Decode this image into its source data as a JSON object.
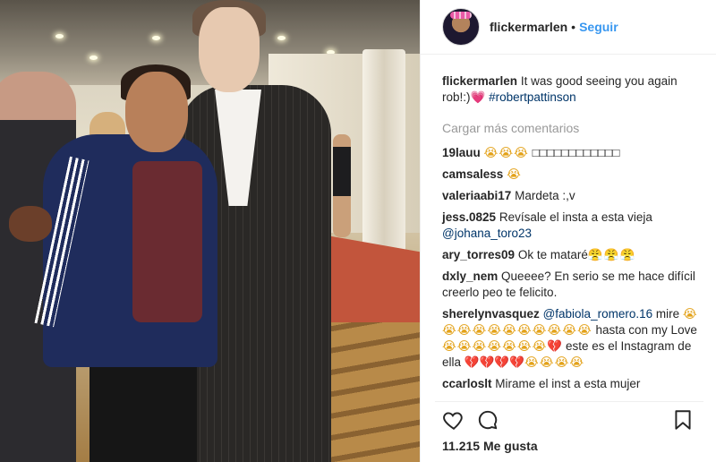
{
  "header": {
    "username": "flickermarlen",
    "separator": "•",
    "follow_label": "Seguir"
  },
  "caption": {
    "username": "flickermarlen",
    "text": "It was good seeing you again rob!:)",
    "emoji": "💗",
    "hashtag": "#robertpattinson"
  },
  "load_more_label": "Cargar más comentarios",
  "comments": [
    {
      "user": "19lauu",
      "text": "😭😭😭",
      "extra": "□□□□□□□□□□□□"
    },
    {
      "user": "camsaless",
      "text": "😭"
    },
    {
      "user": "valeriaabi17",
      "text": "Mardeta :,v"
    },
    {
      "user": "jess.0825",
      "text": "Revísale el insta a esta vieja",
      "mention": "@johana_toro23"
    },
    {
      "user": "ary_torres09",
      "text": "Ok te mataré",
      "emoji": "😤😤😤"
    },
    {
      "user": "dxly_nem",
      "text": "Queeee? En serio se me hace difícil creerlo peo te felicito."
    },
    {
      "user": "sherelynvasquez",
      "mention": "@fabiola_romero.16",
      "text_a": "mire",
      "emoji_a": "😭😭😭😭😭😭😭😭😭😭😭",
      "text_b": "hasta con my Love",
      "emoji_b": "😭😭😭😭😭😭😭",
      "heart_b": "💔",
      "text_c": "este es el Instagram de ella",
      "heart_c": "💔💔💔💔",
      "emoji_c": "😭😭😭😭"
    },
    {
      "user": "ccarloslt",
      "text": "Mirame el inst a esta mujer"
    }
  ],
  "actions": {
    "like_icon": "heart-outline-icon",
    "comment_icon": "comment-bubble-icon",
    "save_icon": "bookmark-icon"
  },
  "likes_label": "11.215 Me gusta"
}
